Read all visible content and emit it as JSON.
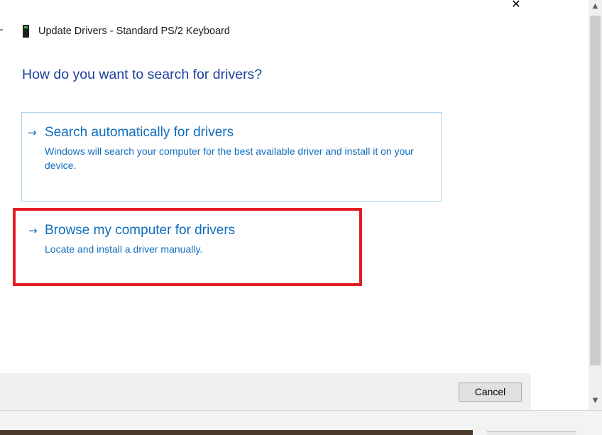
{
  "header": {
    "title": "Update Drivers - Standard PS/2 Keyboard",
    "icon": "keyboard-device-icon"
  },
  "question": "How do you want to search for drivers?",
  "options": [
    {
      "arrow": "→",
      "title": "Search automatically for drivers",
      "description": "Windows will search your computer for the best available driver and install it on your device."
    },
    {
      "arrow": "→",
      "title": "Browse my computer for drivers",
      "description": "Locate and install a driver manually.",
      "highlighted": true,
      "highlight_color": "#e31d25"
    }
  ],
  "footer": {
    "cancel_label": "Cancel"
  },
  "window": {
    "close_glyph": "✕"
  },
  "scrollbar": {
    "up_glyph": "▲",
    "down_glyph": "▼"
  },
  "colors": {
    "link_blue": "#0f6cbd",
    "heading_blue": "#1c3f99",
    "highlight_red": "#e31d25"
  }
}
